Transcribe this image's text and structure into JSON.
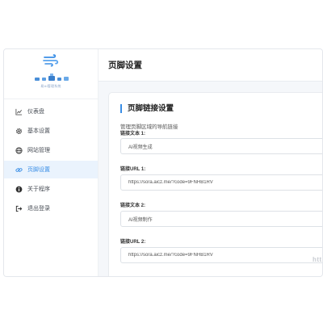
{
  "brand": {
    "name": "易AI管理系统"
  },
  "sidebar": {
    "items": [
      {
        "label": "仪表盘",
        "icon": "chart-line-icon",
        "active": false
      },
      {
        "label": "基本设置",
        "icon": "gear-icon",
        "active": false
      },
      {
        "label": "网站管理",
        "icon": "globe-icon",
        "active": false
      },
      {
        "label": "页脚设置",
        "icon": "link-icon",
        "active": true
      },
      {
        "label": "关于程序",
        "icon": "info-icon",
        "active": false
      },
      {
        "label": "退出登录",
        "icon": "logout-icon",
        "active": false
      }
    ]
  },
  "header": {
    "title": "页脚设置"
  },
  "section": {
    "title": "页脚链接设置",
    "description": "管理页脚区域的导航链接"
  },
  "fields": [
    {
      "label": "链接文本 1:",
      "value": "AI视频生成"
    },
    {
      "label": "链接URL 1:",
      "value": "https://sora.aicz.me/?code=9FNHB1RV"
    },
    {
      "label": "链接文本 2:",
      "value": "AI视频制作"
    },
    {
      "label": "链接URL 2:",
      "value": "https://sora.aicz.me/?code=9FNHB1RV"
    }
  ],
  "overflow_hint": "http",
  "colors": {
    "accent": "#3a8ee6",
    "sidebar_active_bg": "#eaf3fd",
    "background": "#f5f7fa"
  }
}
